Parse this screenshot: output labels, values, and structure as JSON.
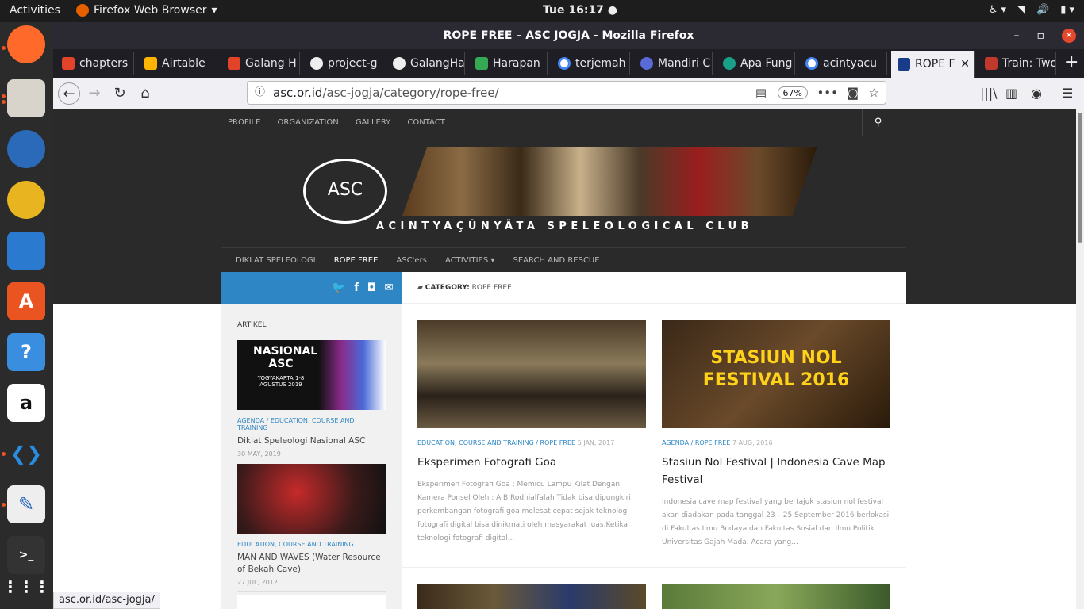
{
  "system": {
    "activities": "Activities",
    "app": "Firefox Web Browser",
    "clock": "Tue 16:17 ●"
  },
  "window": {
    "title": "ROPE FREE – ASC JOGJA - Mozilla Firefox"
  },
  "tabs": [
    "chapters",
    "Airtable",
    "Galang H",
    "project-g",
    "GalangHa",
    "Harapan",
    "terjemah",
    "Mandiri C",
    "Apa Fung",
    "acintyacu",
    "ROPE F",
    "Train: Two"
  ],
  "nav": {
    "url_host": "asc.or.id",
    "url_path": "/asc-jogja/category/rope-free/",
    "zoom": "67%"
  },
  "site": {
    "top_menu": [
      "PROFILE",
      "ORGANIZATION",
      "GALLERY",
      "CONTACT"
    ],
    "logo_text": "ASC",
    "club_name": "ACINTYAÇÛNYÄTA SPELEOLOGICAL CLUB",
    "main_menu": [
      "DIKLAT SPELEOLOGI",
      "ROPE FREE",
      "ASC'ers",
      "ACTIVITIES ▾",
      "SEARCH AND RESCUE"
    ],
    "category_label": "CATEGORY:",
    "category_name": "ROPE FREE",
    "sidebar_heading": "ARTIKEL",
    "sidebar_items": [
      {
        "cat": "AGENDA / EDUCATION, COURSE AND TRAINING",
        "title": "Diklat Speleologi Nasional ASC",
        "date": "30 MAY, 2019",
        "img_title": "NASIONAL ASC",
        "img_sub": "YOGYAKARTA 1-8 AGUSTUS 2019"
      },
      {
        "cat": "EDUCATION, COURSE AND TRAINING",
        "title": "MAN AND WAVES (Water Resource of Bekah Cave)",
        "date": "27 JUL, 2012"
      }
    ],
    "posts": [
      {
        "cat": "EDUCATION, COURSE AND TRAINING / ROPE FREE",
        "date": "5 JAN, 2017",
        "title": "Eksperimen Fotografi Goa",
        "excerpt": "Eksperimen Fotografi Goa : Memicu Lampu Kilat Dengan Kamera Ponsel Oleh : A.B Rodhialfalah Tidak bisa dipungkiri, perkembangan fotografi goa melesat cepat sejak teknologi fotografi digital bisa dinikmati oleh masyarakat luas.Ketika teknologi fotografi digital..."
      },
      {
        "cat": "AGENDA / ROPE FREE",
        "date": "7 AUG, 2016",
        "title": "Stasiun Nol Festival | Indonesia Cave Map Festival",
        "excerpt": "Indonesia cave map festival yang bertajuk stasiun nol festival akan diadakan pada tanggal 23 – 25 September 2016 berlokasi di Fakultas Ilmu Budaya dan Fakultas Sosial dan Ilmu Politik Universitas Gajah Mada. Acara yang...",
        "img_text": "STASIUN NOL FESTIVAL 2016"
      }
    ]
  },
  "status_url": "asc.or.id/asc-jogja/"
}
